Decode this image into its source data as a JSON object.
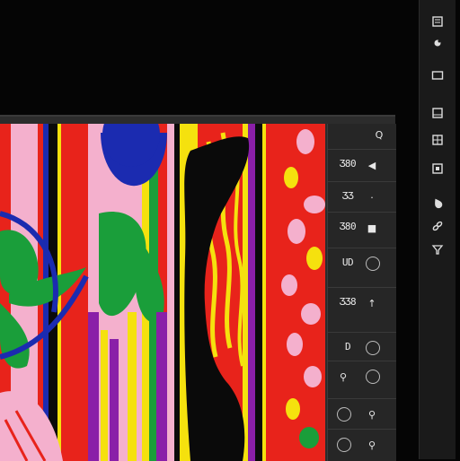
{
  "toolbar": {
    "tools": [
      {
        "name": "layers-icon"
      },
      {
        "name": "brush-icon"
      },
      {
        "name": "rectangle-icon"
      },
      {
        "name": "layout-icon"
      },
      {
        "name": "grid-icon"
      },
      {
        "name": "transform-icon"
      },
      {
        "name": "drop-icon"
      },
      {
        "name": "link-icon"
      },
      {
        "name": "funnel-icon"
      }
    ]
  },
  "side_panel": {
    "search_glyph": "Q",
    "rows": [
      {
        "label": "Ʒ80",
        "icon": "chevron-left-icon",
        "glyph": "◀"
      },
      {
        "label": "ƷƷ",
        "icon": "dot-icon",
        "glyph": "·"
      },
      {
        "label": "Ʒ80",
        "icon": "square-icon",
        "glyph": "■"
      },
      {
        "label": "UD",
        "icon": "circle-settings-icon",
        "glyph": "◎"
      },
      {
        "label": "ƷƷ8",
        "icon": "arrow-up-icon",
        "glyph": "↑"
      },
      {
        "label": "D",
        "icon": "circle-settings-icon",
        "glyph": "◎"
      },
      {
        "label": "",
        "icon": "circle-settings-icon",
        "glyph": "◎"
      },
      {
        "label": "",
        "icon": "pin-icon",
        "glyph": "⚲"
      },
      {
        "label": "",
        "icon": "pin-icon",
        "glyph": "⚲"
      }
    ]
  },
  "colors": {
    "background": "#050505",
    "toolbar": "#1a1a1a",
    "panel": "#2c2c2c",
    "art_red": "#e8231b",
    "art_yellow": "#f5e10e",
    "art_pink": "#f4b0cd",
    "art_blue": "#1b2bb0",
    "art_green": "#1a9e3a",
    "art_black": "#0a0a0a",
    "art_purple": "#8a1fa8"
  }
}
